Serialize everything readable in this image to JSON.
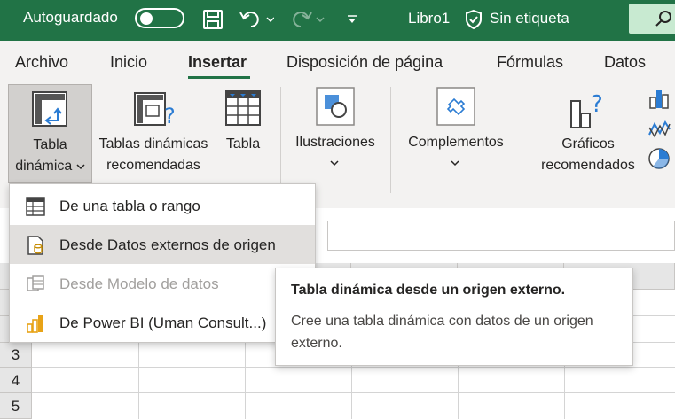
{
  "titlebar": {
    "autosave_label": "Autoguardado",
    "title": "Libro1",
    "sensitivity": "Sin etiqueta",
    "bg_color": "#217346"
  },
  "tabs": [
    {
      "label": "Archivo"
    },
    {
      "label": "Inicio"
    },
    {
      "label": "Insertar",
      "active": true
    },
    {
      "label": "Disposición de página"
    },
    {
      "label": "Fórmulas"
    },
    {
      "label": "Datos"
    }
  ],
  "ribbon": {
    "pivot_table": {
      "line1": "Tabla",
      "line2": "dinámica"
    },
    "recommended_pivot": {
      "line1": "Tablas dinámicas",
      "line2": "recomendadas"
    },
    "table": {
      "label": "Tabla"
    },
    "illustrations": {
      "label": "Ilustraciones"
    },
    "addins": {
      "label": "Complementos"
    },
    "recommended_charts": {
      "line1": "Gráficos",
      "line2": "recomendados"
    }
  },
  "menu": {
    "items": [
      {
        "label": "De una tabla o rango",
        "icon": "table-range-icon"
      },
      {
        "label": "Desde Datos externos de origen",
        "icon": "external-data-icon",
        "hover": true
      },
      {
        "label": "Desde Modelo de datos",
        "icon": "data-model-icon",
        "disabled": true
      },
      {
        "label": "De Power BI (Uman Consult...)",
        "icon": "power-bi-icon"
      }
    ]
  },
  "tooltip": {
    "title": "Tabla dinámica desde un origen externo.",
    "body": "Cree una tabla dinámica con datos de un origen externo."
  },
  "grid": {
    "rows": [
      "3",
      "4",
      "5"
    ]
  },
  "colors": {
    "accent": "#217346",
    "power_bi": "#e8a317"
  }
}
